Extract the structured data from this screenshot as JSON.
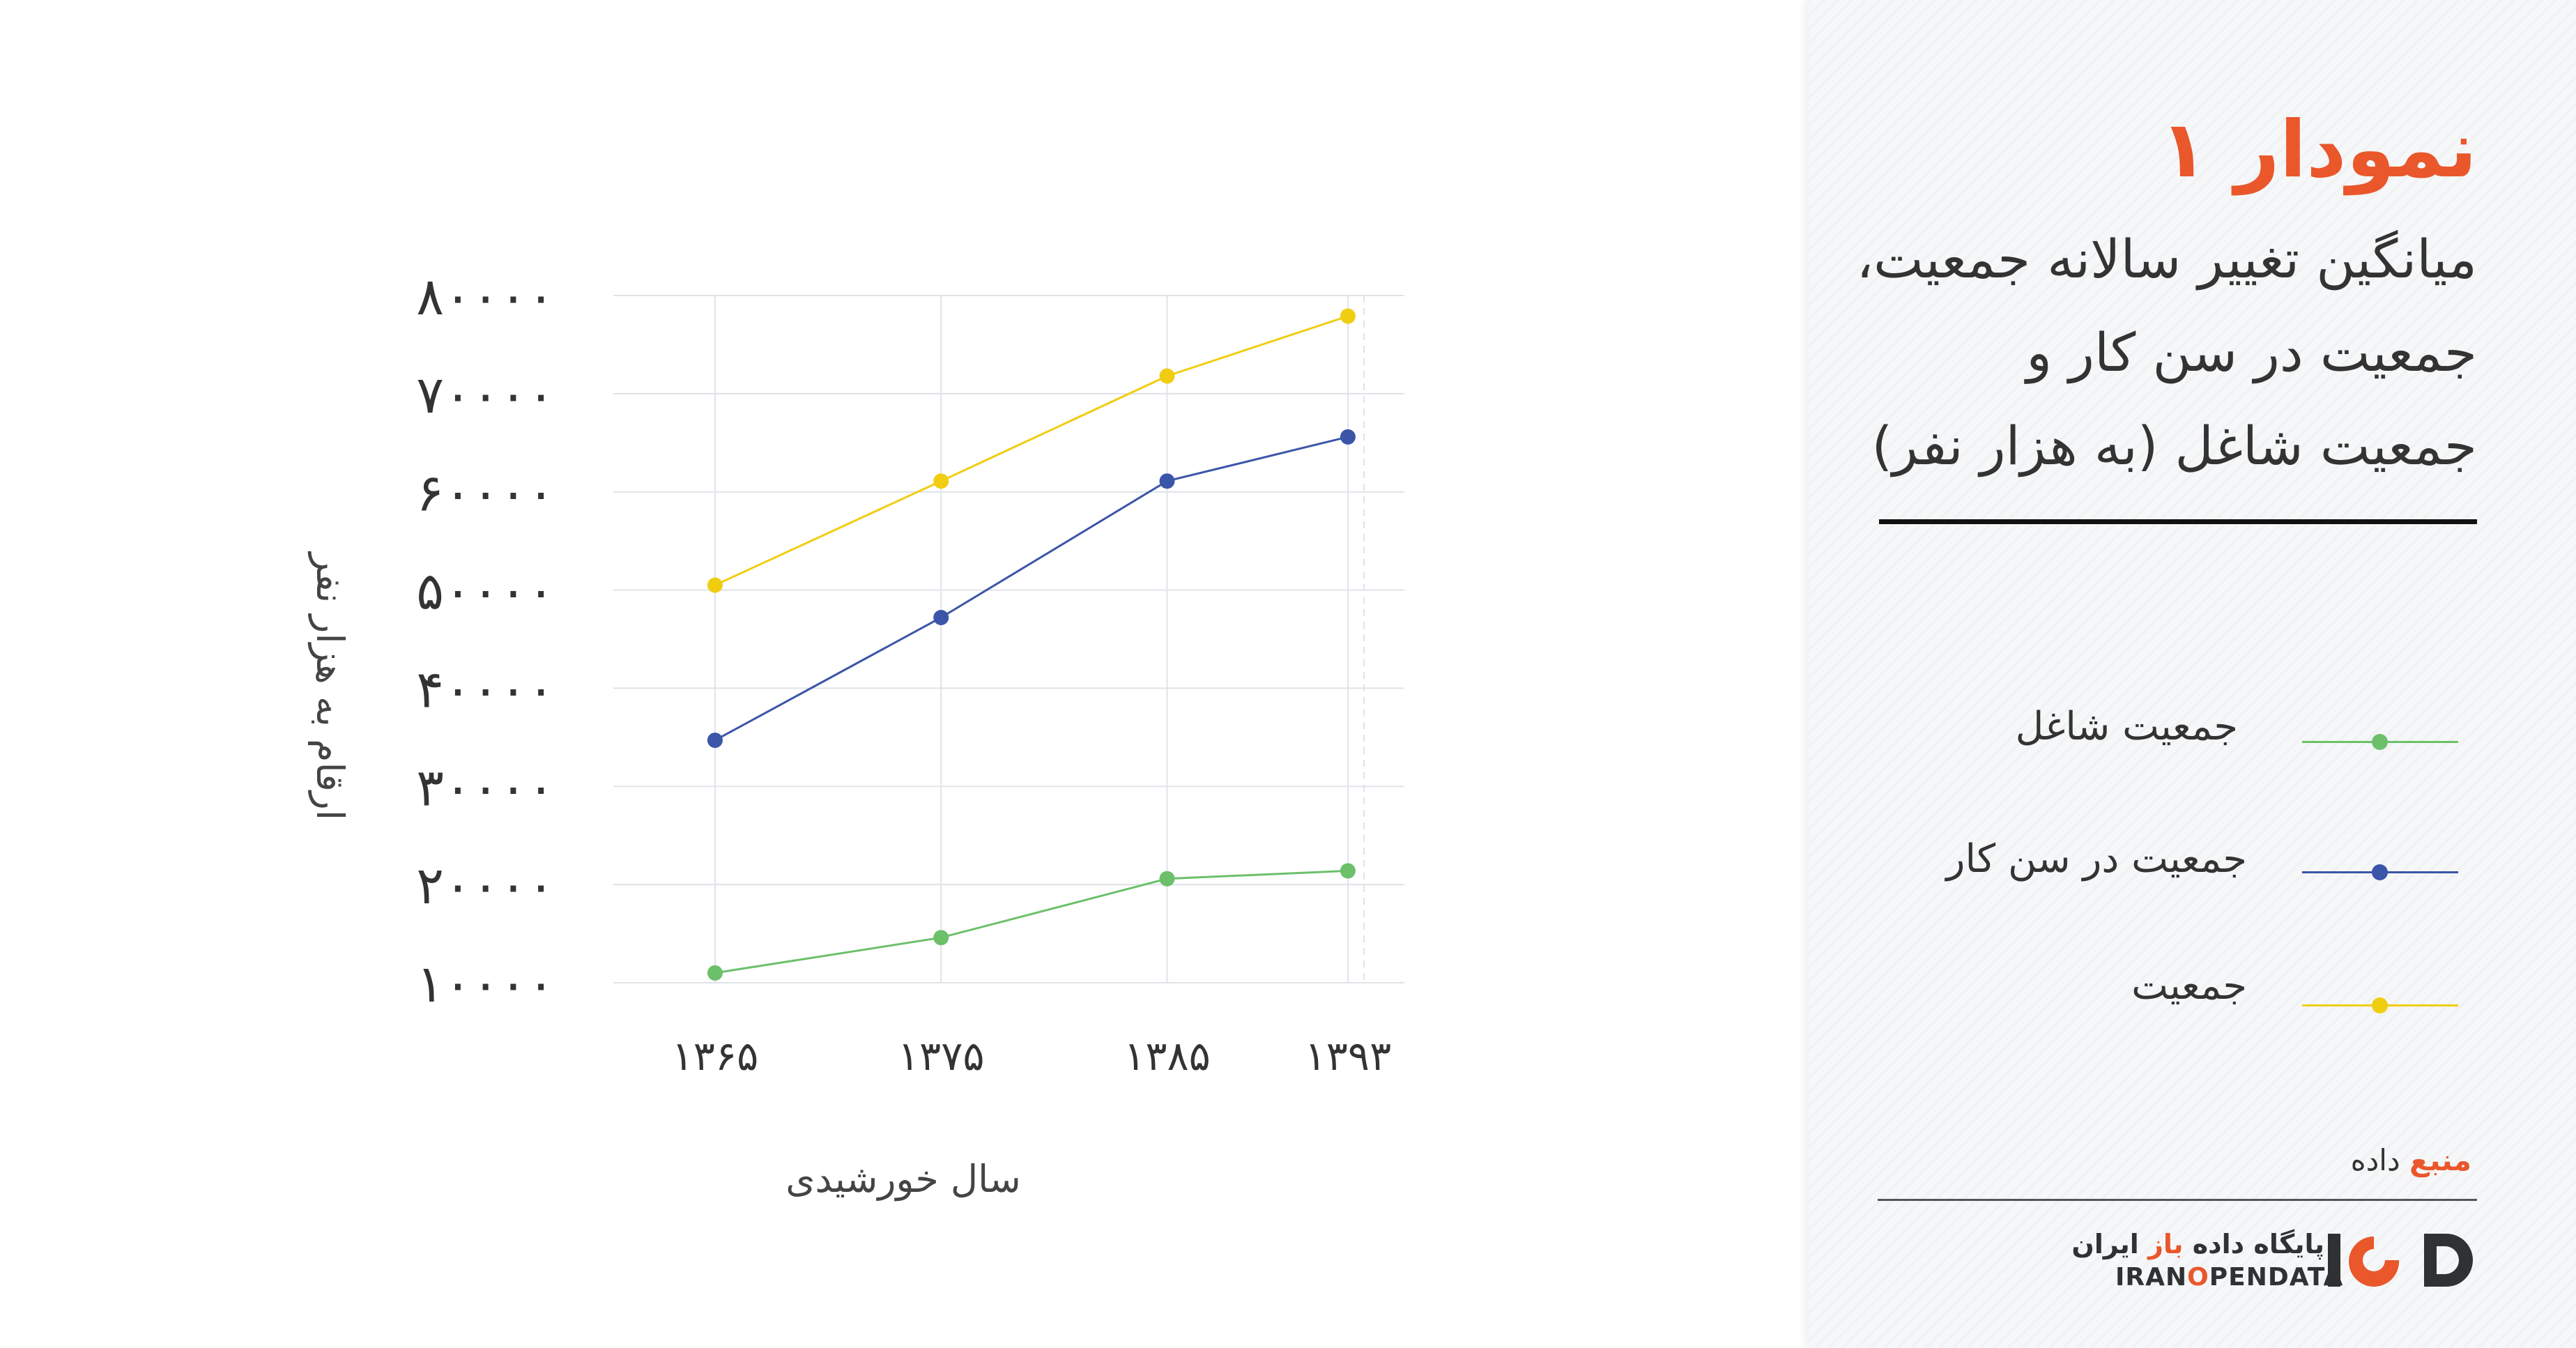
{
  "panel": {
    "title": "نمودار ۱",
    "subtitle_lines": [
      "میانگین تغییر سالانه جمعیت،",
      "جمعیت در سن کار و",
      "جمعیت شاغل (به هزار نفر)"
    ],
    "source_accent": "منبع",
    "source_rest": " داده",
    "logo": {
      "fa_main": "پایگاه داده ",
      "fa_accent": "باز",
      "fa_end": " ایران",
      "en_part1": "IRAN",
      "en_accent": "O",
      "en_part2": "PENDATA"
    }
  },
  "colors": {
    "accent": "#e9572b",
    "employed": "#6cc06a",
    "working_age": "#3b55a8",
    "population": "#f1cd12",
    "grid": "#dfe3e8"
  },
  "chart_data": {
    "type": "line",
    "x": [
      "۱۳۶۵",
      "۱۳۷۵",
      "۱۳۸۵",
      "۱۳۹۳"
    ],
    "x_years": [
      1365,
      1375,
      1385,
      1393
    ],
    "xlabel": "سال خورشیدی",
    "ylabel": "ارقام به هزار نفر",
    "ylim": [
      10000,
      80000
    ],
    "yticks": [
      10000,
      20000,
      30000,
      40000,
      50000,
      60000,
      70000,
      80000
    ],
    "ytick_labels": [
      "۱۰۰۰۰",
      "۲۰۰۰۰",
      "۳۰۰۰۰",
      "۴۰۰۰۰",
      "۵۰۰۰۰",
      "۶۰۰۰۰",
      "۷۰۰۰۰",
      "۸۰۰۰۰"
    ],
    "grid": true,
    "legend_position": "right-panel",
    "series": [
      {
        "name": "جمعیت شاغل",
        "color": "#6cc06a",
        "values": [
          11000,
          14600,
          20600,
          21400
        ]
      },
      {
        "name": "جمعیت در سن کار",
        "color": "#3b55a8",
        "values": [
          34700,
          47200,
          61100,
          65600
        ]
      },
      {
        "name": "جمعیت",
        "color": "#f1cd12",
        "values": [
          50500,
          61100,
          71800,
          77900
        ]
      }
    ]
  }
}
